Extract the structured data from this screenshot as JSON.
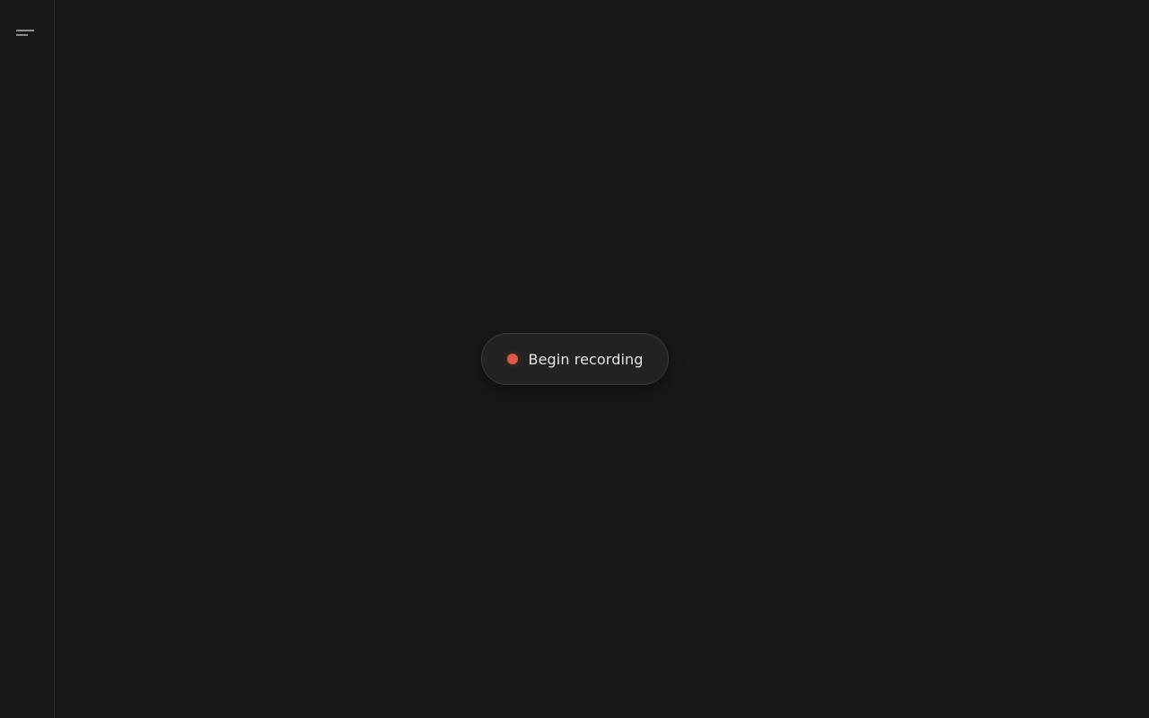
{
  "sidebar": {
    "menu_icon": "menu-icon"
  },
  "main": {
    "record_button": {
      "label": "Begin recording",
      "icon": "record-dot-icon",
      "dot_color": "#e0574a"
    }
  },
  "colors": {
    "background": "#181818",
    "button_background": "#222221",
    "button_border": "#3a3a38",
    "text": "#e8e6e1",
    "accent_red": "#e0574a"
  }
}
